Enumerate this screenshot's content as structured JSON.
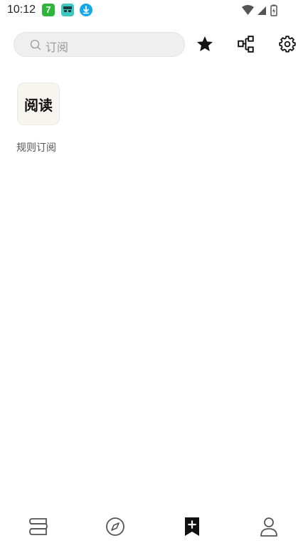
{
  "status_bar": {
    "time": "10:12",
    "app_badge_text": "7"
  },
  "search": {
    "placeholder": "订阅"
  },
  "toolbar": {
    "icons": [
      "star-icon",
      "flow-icon",
      "gear-icon"
    ]
  },
  "sources": [
    {
      "icon_text": "阅读",
      "label": "规则订阅"
    }
  ],
  "bottom_nav": {
    "items": [
      "bookshelf-icon",
      "compass-icon",
      "bookmark-add-icon",
      "person-icon"
    ],
    "active_index": 2
  }
}
